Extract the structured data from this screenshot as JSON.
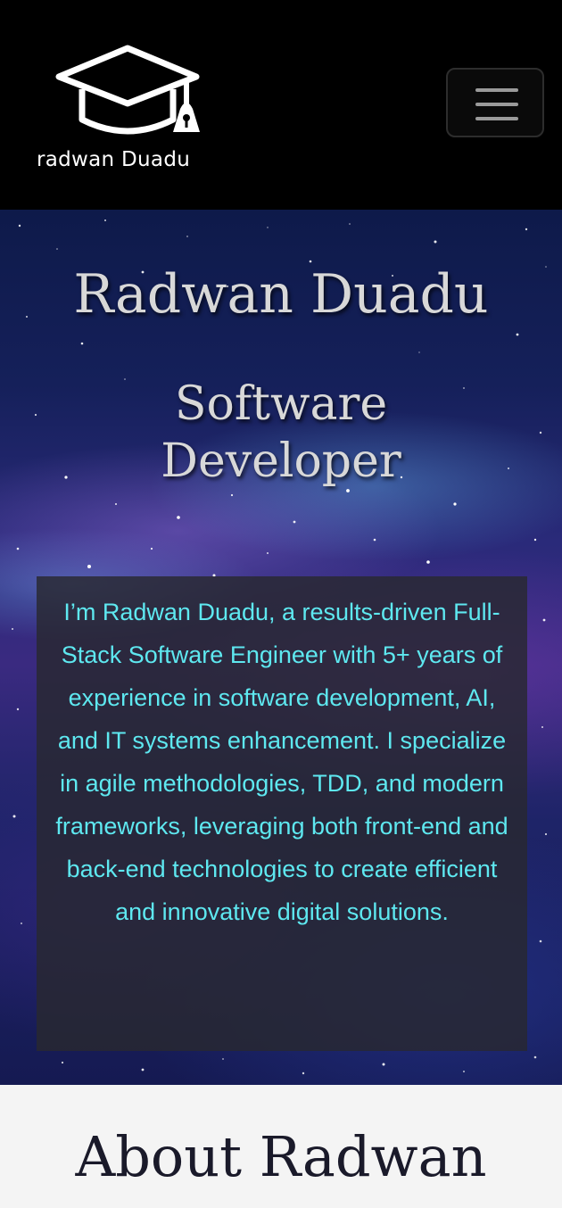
{
  "header": {
    "brand_text": "radwan Duadu",
    "logo_icon": "graduation-cap-icon",
    "menu_icon": "hamburger-menu-icon"
  },
  "hero": {
    "name": "Radwan Duadu",
    "role": "Software Developer",
    "bio": "I’m Radwan Duadu, a results-driven Full-Stack Software Engineer with 5+ years of experience in software development, AI, and IT systems enhancement. I specialize in agile methodologies, TDD, and modern frameworks, leveraging both front-end and back-end technologies to create efficient and innovative digital solutions."
  },
  "about": {
    "title": "About Radwan"
  },
  "colors": {
    "header_bg": "#000000",
    "bio_text": "#5ee8f0",
    "heading_text": "#d8d8d8",
    "about_bg": "#f4f4f4"
  }
}
